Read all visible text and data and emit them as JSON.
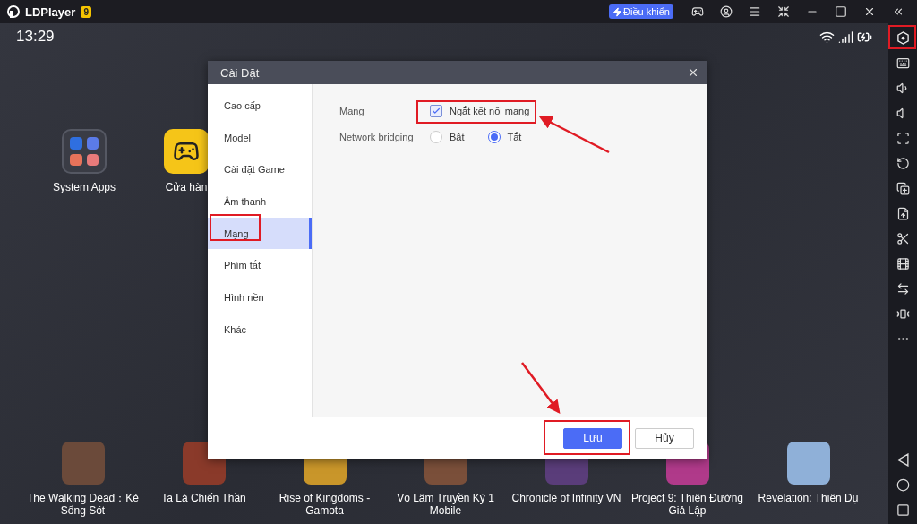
{
  "titlebar": {
    "app_name": "LDPlayer",
    "version_badge": "9",
    "control_button": "Điều khiển"
  },
  "status_bar": {
    "time": "13:29"
  },
  "desktop_apps": [
    {
      "label": "System Apps",
      "kind": "folder"
    },
    {
      "label": "Cửa hàn",
      "kind": "store"
    }
  ],
  "dock_apps": [
    {
      "label": "The Walking Dead：Kẻ Sống Sót"
    },
    {
      "label": "Ta Là Chiến Thần"
    },
    {
      "label": "Rise of Kingdoms - Gamota"
    },
    {
      "label": "Võ Lâm Truyền Kỳ 1 Mobile"
    },
    {
      "label": "Chronicle of Infinity VN"
    },
    {
      "label": "Project 9: Thiên Đường Giả Lập"
    },
    {
      "label": "Revelation: Thiên Dụ"
    }
  ],
  "dialog": {
    "title": "Cài Đặt",
    "menu": [
      {
        "label": "Cao cấp",
        "selected": false
      },
      {
        "label": "Model",
        "selected": false
      },
      {
        "label": "Cài đặt Game",
        "selected": false
      },
      {
        "label": "Âm thanh",
        "selected": false
      },
      {
        "label": "Mạng",
        "selected": true
      },
      {
        "label": "Phím tắt",
        "selected": false
      },
      {
        "label": "Hình nền",
        "selected": false
      },
      {
        "label": "Khác",
        "selected": false
      }
    ],
    "settings": [
      {
        "kind": "checkbox",
        "label": "Mạng",
        "options": [
          {
            "label": "Ngắt kết nối mạng",
            "checked": true
          }
        ]
      },
      {
        "kind": "radio",
        "label": "Network bridging",
        "options": [
          {
            "label": "Bật",
            "selected": false
          },
          {
            "label": "Tắt",
            "selected": true
          }
        ]
      }
    ],
    "buttons": [
      {
        "label": "Lưu",
        "kind": "primary"
      },
      {
        "label": "Hủy",
        "kind": "secondary"
      }
    ]
  }
}
